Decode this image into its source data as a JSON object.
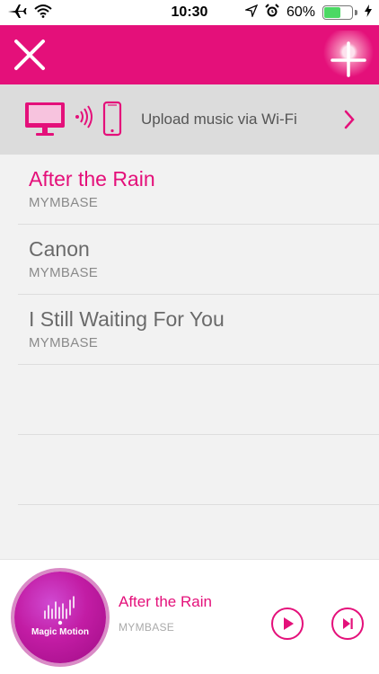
{
  "status_bar": {
    "time": "10:30",
    "battery_percent_label": "60%",
    "battery_level": 0.6,
    "icons": [
      "airplane-icon",
      "wifi-icon",
      "location-icon",
      "alarm-icon",
      "charging-icon"
    ]
  },
  "header": {
    "close_icon": "close-icon",
    "add_icon": "add-icon",
    "background_color": "#e4107a"
  },
  "upload_banner": {
    "label": "Upload music via Wi-Fi",
    "icons": [
      "monitor-icon",
      "wireless-signal-icon",
      "phone-icon",
      "chevron-right-icon"
    ]
  },
  "songs": [
    {
      "title": "After the Rain",
      "artist": "MYMBASE",
      "active": true
    },
    {
      "title": "Canon",
      "artist": "MYMBASE",
      "active": false
    },
    {
      "title": "I Still Waiting For You",
      "artist": "MYMBASE",
      "active": false
    }
  ],
  "player": {
    "album_label": "Magic Motion",
    "title": "After the Rain",
    "artist": "MYMBASE",
    "play_icon": "play-icon",
    "next_icon": "skip-next-icon"
  },
  "colors": {
    "accent": "#e4107a",
    "banner_bg": "#dcdcdc",
    "list_bg": "#f2f2f2"
  }
}
